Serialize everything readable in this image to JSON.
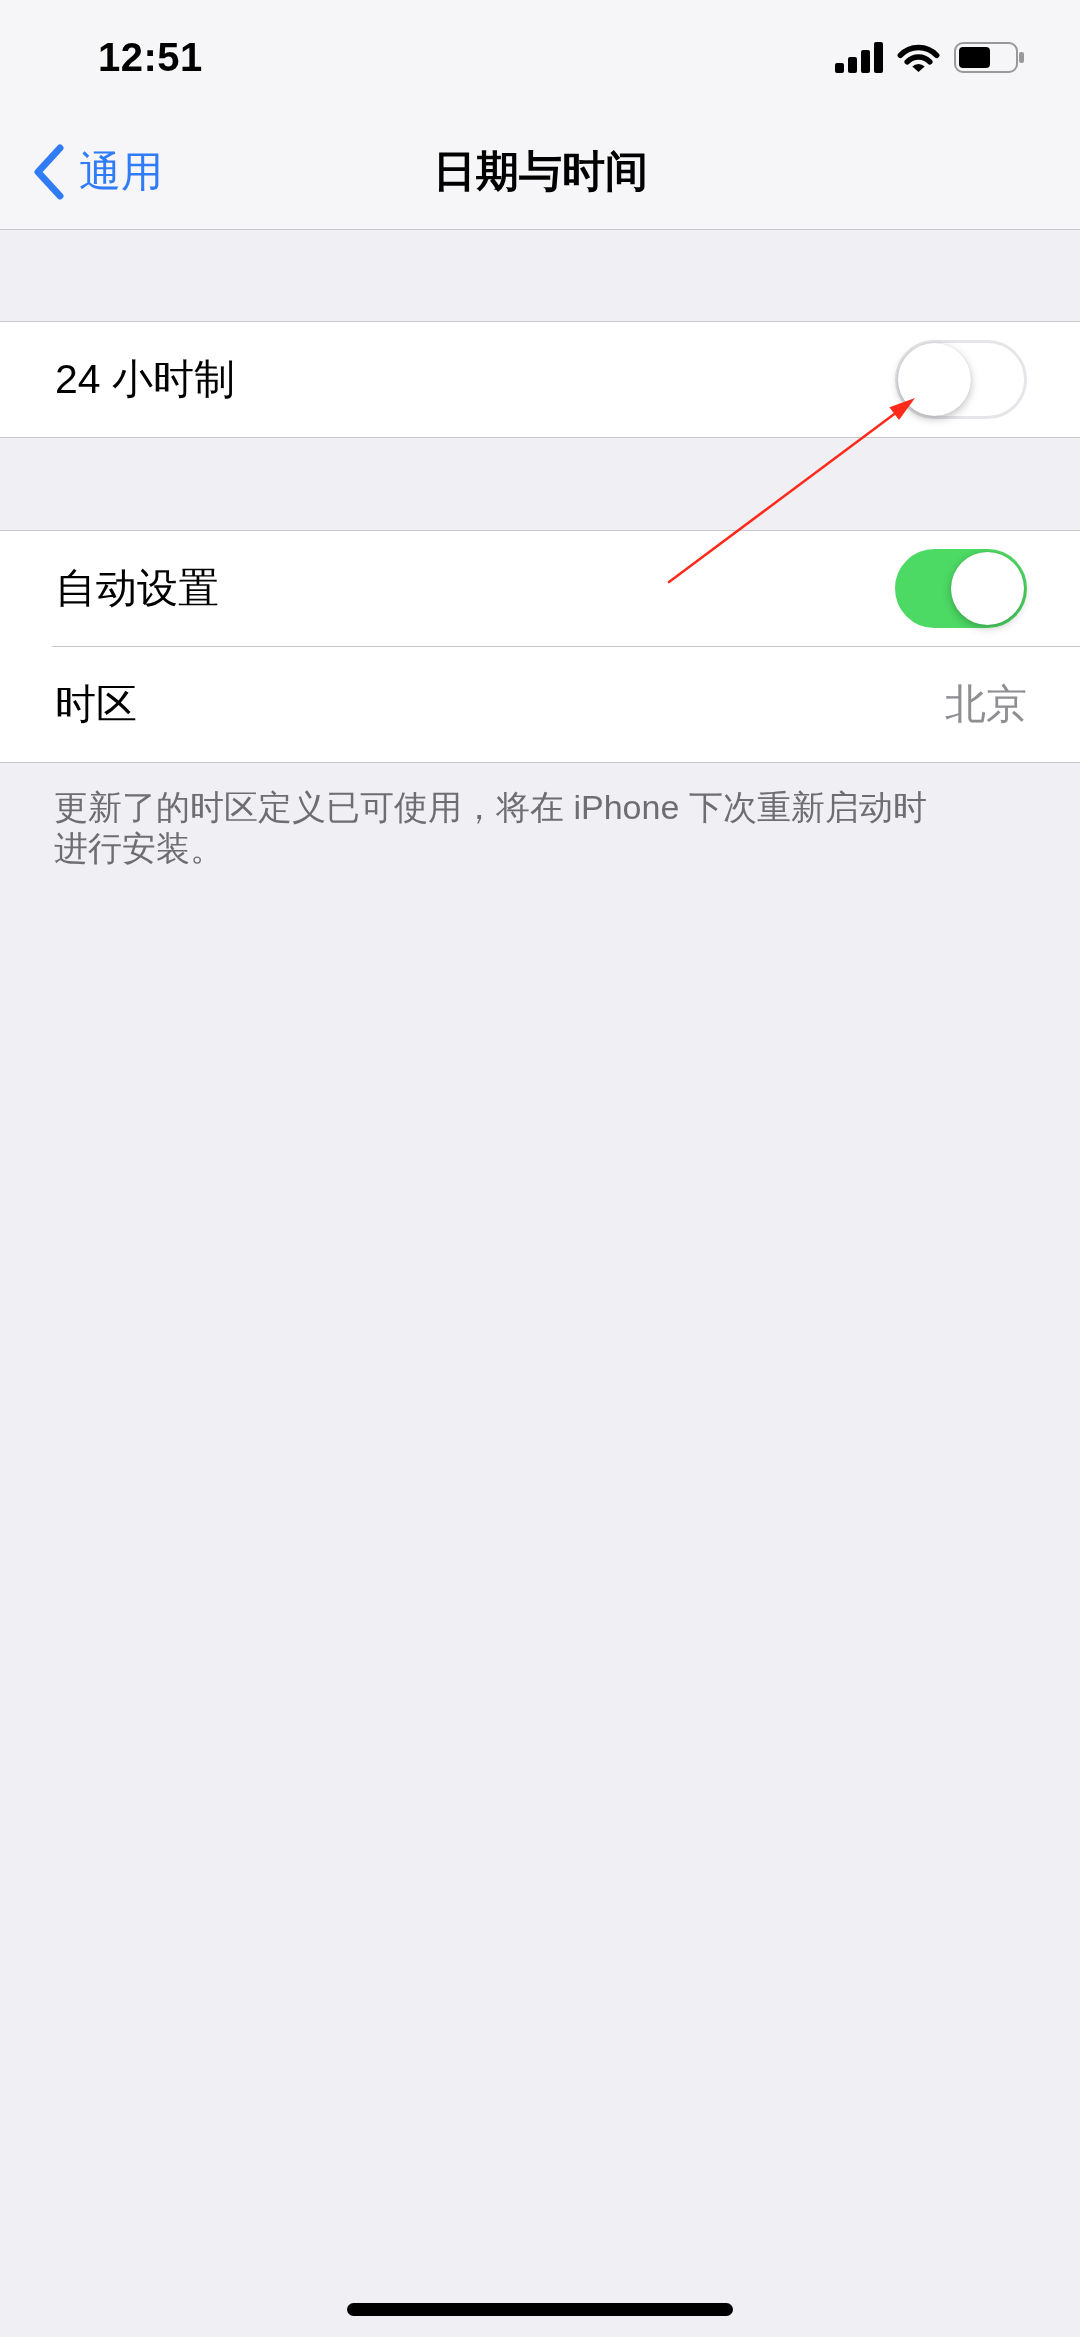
{
  "status_bar": {
    "time": "12:51"
  },
  "nav_bar": {
    "back_label": "通用",
    "title": "日期与时间"
  },
  "groups": [
    {
      "rows": [
        {
          "kind": "toggle",
          "label": "24 小时制",
          "on": false
        }
      ]
    },
    {
      "rows": [
        {
          "kind": "toggle",
          "label": "自动设置",
          "on": true
        },
        {
          "kind": "value",
          "label": "时区",
          "value": "北京"
        }
      ],
      "footer": "更新了的时区定义已可使用，将在 iPhone 下次重新启动时进行安装。"
    }
  ]
}
